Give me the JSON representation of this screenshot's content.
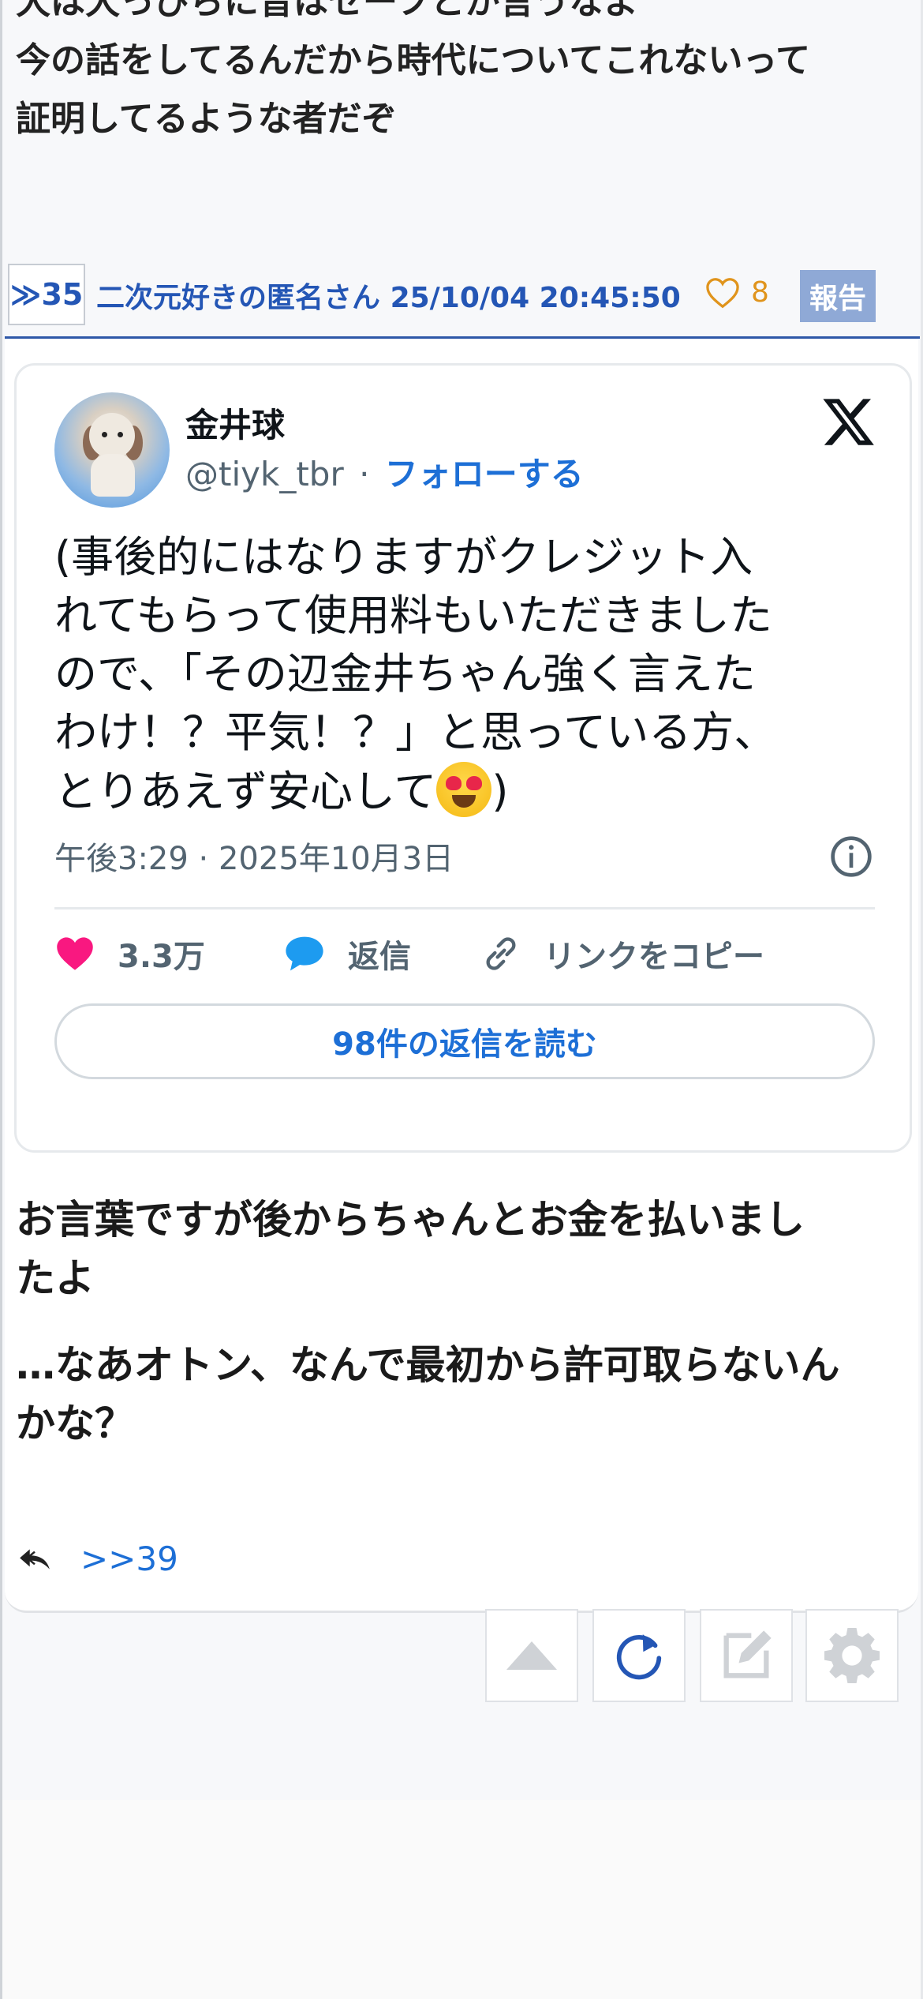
{
  "previous_post": {
    "lines": [
      "犬は犬っぴらに音はセーフとか言うなよ",
      "今の話をしてるんだから時代についてこれないって",
      "証明してるような者だぞ"
    ]
  },
  "post": {
    "anchor": "≫35",
    "author": "二次元好きの匿名さん",
    "datetime": "25/10/04 20:45:50",
    "like_count": "8",
    "report_label": "報告"
  },
  "tweet": {
    "author_name": "金井球",
    "handle": "@tiyk_tbr",
    "separator": "·",
    "follow_label": "フォローする",
    "text_lines": [
      "(事後的にはなりますがクレジット入",
      "れてもらって使用料もいただきました",
      "ので、「その辺金井ちゃん強く言えた",
      "わけ！？平気！？」と思っている方、"
    ],
    "last_line_before_emoji": "とりあえず安心して",
    "last_line_after_emoji": ")",
    "timestamp": "午後3:29 · 2025年10月3日",
    "likes": "3.3万",
    "reply_label": "返信",
    "copy_link_label": "リンクをコピー",
    "read_replies_label": "98件の返信を読む"
  },
  "reply": {
    "paragraph1": [
      "お言葉ですが後からちゃんとお金を払いまし",
      "たよ"
    ],
    "paragraph2": [
      "…なあオトン、なんで最初から許可取らないん",
      "かな？"
    ]
  },
  "backlink": ">>39",
  "toolbar": [
    "scroll-top",
    "reload",
    "compose",
    "settings"
  ],
  "colors": {
    "link_blue": "#2456b5",
    "tweet_blue": "#1d6fd6",
    "like_orange": "#e0941c",
    "heart_pink": "#f91880",
    "report_bg": "#8fa9d6"
  }
}
